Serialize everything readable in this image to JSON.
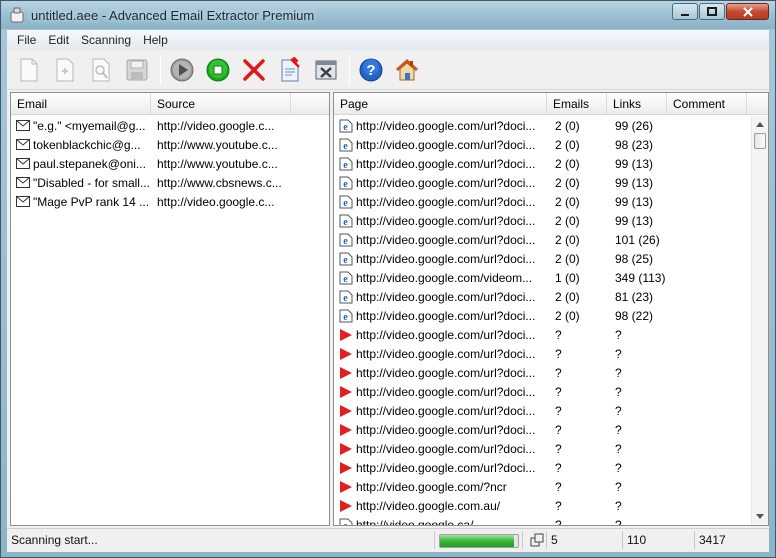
{
  "window": {
    "title": "untitled.aee - Advanced Email Extractor Premium",
    "controls": {
      "minimize": "minimize",
      "maximize": "maximize",
      "close": "close"
    }
  },
  "menu": [
    "File",
    "Edit",
    "Scanning",
    "Help"
  ],
  "toolbar": [
    {
      "name": "new-document",
      "icon": "new-document-icon",
      "enabled": false
    },
    {
      "name": "add-document",
      "icon": "add-document-icon",
      "enabled": false
    },
    {
      "name": "find-document",
      "icon": "find-document-icon",
      "enabled": false
    },
    {
      "name": "save",
      "icon": "floppy-disk-icon",
      "enabled": false
    },
    {
      "name": "start",
      "icon": "play-icon",
      "enabled": true
    },
    {
      "name": "stop",
      "icon": "stop-icon",
      "enabled": true
    },
    {
      "name": "delete",
      "icon": "red-x-icon",
      "enabled": true
    },
    {
      "name": "remove-email",
      "icon": "document-remove-icon",
      "enabled": true
    },
    {
      "name": "export",
      "icon": "export-x-icon",
      "enabled": true
    },
    {
      "name": "help",
      "icon": "help-icon",
      "enabled": true
    },
    {
      "name": "home",
      "icon": "home-icon",
      "enabled": true
    }
  ],
  "emails_pane": {
    "columns": [
      "Email",
      "Source"
    ],
    "rows": [
      {
        "email": "\"e.g.\" <myemail@g...",
        "source": "http://video.google.c..."
      },
      {
        "email": "tokenblackchic@g...",
        "source": "http://www.youtube.c..."
      },
      {
        "email": "paul.stepanek@oni...",
        "source": "http://www.youtube.c..."
      },
      {
        "email": "\"Disabled - for small...",
        "source": "http://www.cbsnews.c..."
      },
      {
        "email": "\"Mage PvP rank 14 ...",
        "source": "http://video.google.c..."
      }
    ]
  },
  "pages_pane": {
    "columns": [
      "Page",
      "Emails",
      "Links",
      "Comment"
    ],
    "rows": [
      {
        "icon": "ie-page-icon",
        "page": "http://video.google.com/url?doci...",
        "emails": "2 (0)",
        "links": "99 (26)",
        "comment": ""
      },
      {
        "icon": "ie-page-icon",
        "page": "http://video.google.com/url?doci...",
        "emails": "2 (0)",
        "links": "98 (23)",
        "comment": ""
      },
      {
        "icon": "ie-page-icon",
        "page": "http://video.google.com/url?doci...",
        "emails": "2 (0)",
        "links": "99 (13)",
        "comment": ""
      },
      {
        "icon": "ie-page-icon",
        "page": "http://video.google.com/url?doci...",
        "emails": "2 (0)",
        "links": "99 (13)",
        "comment": ""
      },
      {
        "icon": "ie-page-icon",
        "page": "http://video.google.com/url?doci...",
        "emails": "2 (0)",
        "links": "99 (13)",
        "comment": ""
      },
      {
        "icon": "ie-page-icon",
        "page": "http://video.google.com/url?doci...",
        "emails": "2 (0)",
        "links": "99 (13)",
        "comment": ""
      },
      {
        "icon": "ie-page-icon",
        "page": "http://video.google.com/url?doci...",
        "emails": "2 (0)",
        "links": "101 (26)",
        "comment": ""
      },
      {
        "icon": "ie-page-icon",
        "page": "http://video.google.com/url?doci...",
        "emails": "2 (0)",
        "links": "98 (25)",
        "comment": ""
      },
      {
        "icon": "ie-page-icon",
        "page": "http://video.google.com/videom...",
        "emails": "1 (0)",
        "links": "349 (113)",
        "comment": ""
      },
      {
        "icon": "ie-page-icon",
        "page": "http://video.google.com/url?doci...",
        "emails": "2 (0)",
        "links": "81 (23)",
        "comment": ""
      },
      {
        "icon": "ie-page-icon",
        "page": "http://video.google.com/url?doci...",
        "emails": "2 (0)",
        "links": "98 (22)",
        "comment": ""
      },
      {
        "icon": "red-arrow-icon",
        "page": "http://video.google.com/url?doci...",
        "emails": "?",
        "links": "?",
        "comment": ""
      },
      {
        "icon": "red-arrow-icon",
        "page": "http://video.google.com/url?doci...",
        "emails": "?",
        "links": "?",
        "comment": ""
      },
      {
        "icon": "red-arrow-icon",
        "page": "http://video.google.com/url?doci...",
        "emails": "?",
        "links": "?",
        "comment": ""
      },
      {
        "icon": "red-arrow-icon",
        "page": "http://video.google.com/url?doci...",
        "emails": "?",
        "links": "?",
        "comment": ""
      },
      {
        "icon": "red-arrow-icon",
        "page": "http://video.google.com/url?doci...",
        "emails": "?",
        "links": "?",
        "comment": ""
      },
      {
        "icon": "red-arrow-icon",
        "page": "http://video.google.com/url?doci...",
        "emails": "?",
        "links": "?",
        "comment": ""
      },
      {
        "icon": "red-arrow-icon",
        "page": "http://video.google.com/url?doci...",
        "emails": "?",
        "links": "?",
        "comment": ""
      },
      {
        "icon": "red-arrow-icon",
        "page": "http://video.google.com/url?doci...",
        "emails": "?",
        "links": "?",
        "comment": ""
      },
      {
        "icon": "red-arrow-icon",
        "page": "http://video.google.com/?ncr",
        "emails": "?",
        "links": "?",
        "comment": ""
      },
      {
        "icon": "red-arrow-icon",
        "page": "http://video.google.com.au/",
        "emails": "?",
        "links": "?",
        "comment": ""
      },
      {
        "icon": "ie-page-icon",
        "page": "http://video.google.ca/",
        "emails": "?",
        "links": "?",
        "comment": ""
      }
    ]
  },
  "status": {
    "text": "Scanning start...",
    "progress": 0.95,
    "threads": "5",
    "emails_count": "110",
    "pages_count": "3417"
  },
  "colors": {
    "progress": "#37b537",
    "arrow": "#e02020",
    "stop": "#1aa51a",
    "delete": "#e01818",
    "help": "#2463c9"
  }
}
